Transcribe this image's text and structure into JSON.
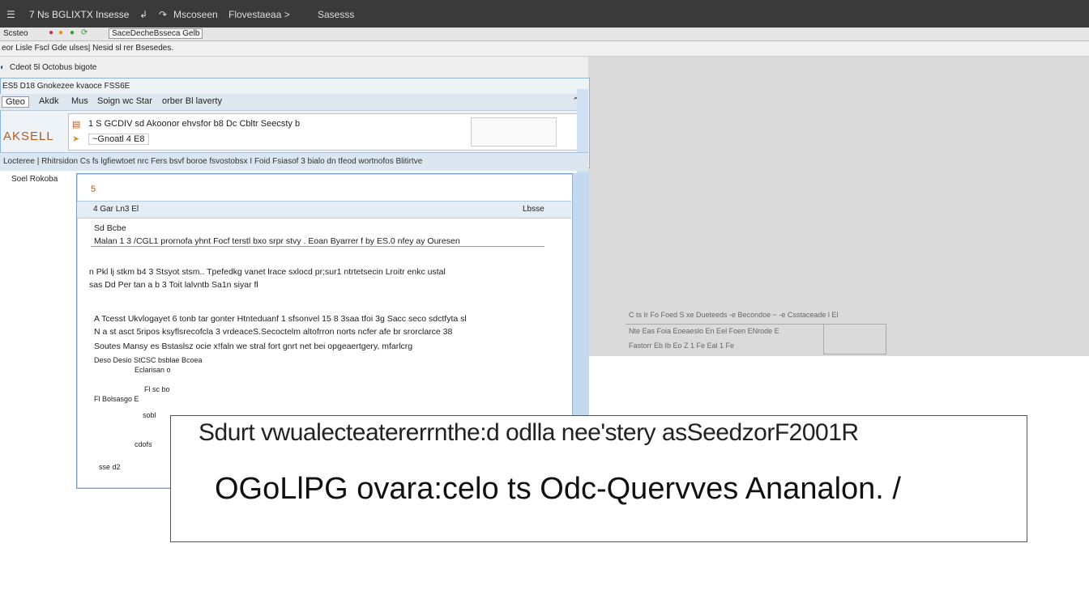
{
  "titlebar": {
    "items": [
      "7 Ns BGLIXTX Insesse",
      "Mscoseen",
      "Flovestaeaa >",
      "Sasesss"
    ],
    "window_icon": "menu-icon"
  },
  "toolbar": {
    "label": "Scsteo",
    "tab": "SaceDecheBsseca Gelb"
  },
  "addressbar": {
    "text": "eor  Lisle  Fscl Gde ulses|  Nesid sl rer Bsesedes."
  },
  "path": {
    "text": "Cdeot 5l Octobus bigote"
  },
  "dialog": {
    "title": "ES5 D18   Gnokezee   kvaoce  FSS6E",
    "tabs": [
      "Gteo",
      "Akdk",
      "Mus",
      "Soign wc Star",
      "orber Bl laverty"
    ],
    "card_line1": "1 S GCDIV sd Akoonor ehvsfor b8 Dc Cbltr Seecsty b",
    "card_line2": "~Gnoatl 4 E8",
    "logo": "AKSELL",
    "ribbon": "Locteree | Rhitrsidon Cs  fs  lgfiewtoet nrc  Fers bsvf  boroe  fsvostobsx  I  Foid  Fsiasof  3  bialo  dn  tfeod  wortnofos  Blitirtve"
  },
  "sidebar": {
    "label": "Soel Rokoba"
  },
  "inner": {
    "top_icon": "5",
    "header_left": "4 Gar  Ln3  El",
    "header_right": "Lbsse",
    "meta": "Sd  Bcbe",
    "lines": [
      "Malan 1 3  /CGL1 prornofa yhnt Focf terstl bxo srpr stvy . Eoan Byarrer f by ES.0  nfey  ay  Ouresen",
      "n Pkl lj stkm b4 3  Stsyot stsm..  Tpefedkg vanet lrace sxlocd pr;sur1 ntrtetsecin Lroitr enkc ustal",
      "sas Dd  Per tan a b  3 Toit lalvntb Sa1n siyar fl",
      "A Tcesst Ukvlogayet 6 tonb tar  gonter Htnteduanf 1  sfsonvel 15 8 3saa tfoi 3g  Sacc seco sdctfyta  sl",
      "N a st asct  5ripos ksyflsrecofcla 3 vrdeaceS.Secoctelm altofrron  norts ncfer afe br  srorclarce 38",
      "Soutes Mansy es Bstaslsz ocie x!faln we stral fort gnrt net bei opgeaertgery, mfarlcrg",
      "Deso            Desio  StCSC bsblae Bcoea"
    ],
    "tree": [
      "Eclarisan o",
      "Fl sc bo",
      "Fl Bolsasgo  E",
      "sobl",
      "cdofs",
      "sse d2"
    ]
  },
  "workspace": {
    "mini_row1": "C   ts   Ir Fo  Foed   S xe Dueteeds   -e   Becondoe   ~  -e   Csstaceade   l    El",
    "mini_row2": "Nte   Eas  Foia  Eoeaeslo   En   Eel   Foen   ENrode  E",
    "mini_row3": "Fastorr  Eb  Ib  Eo   Z   1   Fe    Eal   1   Fe"
  },
  "caption": {
    "line1": "Sdurt vwualecteatererrnthe:d odlla  nee'stery asSeedzorF2001R",
    "line2": "OGoLlPG ovara:celo ts Odc-Quervves Ananalon. /"
  },
  "colors": {
    "titlebar": "#3a3a3a",
    "dialog_border": "#8fb3d6",
    "accent_orange": "#b25a1a",
    "workspace_grey": "#dadada"
  }
}
